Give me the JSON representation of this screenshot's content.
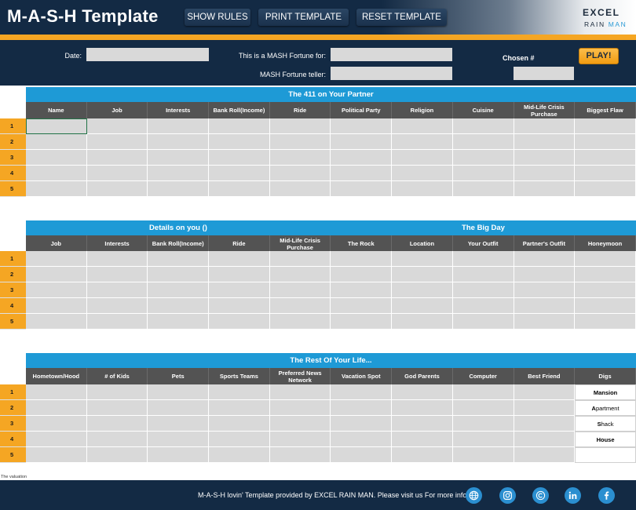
{
  "header": {
    "title": "M-A-S-H  Template",
    "buttons": [
      "SHOW RULES",
      "PRINT TEMPLATE",
      "RESET TEMPLATE"
    ],
    "logo_line1": "EXCEL",
    "logo_rain": "RAIN",
    "logo_man": "MAN"
  },
  "form": {
    "date_label": "Date:",
    "fortune_for_label": "This is a MASH Fortune for:",
    "teller_label": "MASH Fortune teller:",
    "chosen_label": "Chosen #",
    "play_label": "PLAY!",
    "date_value": "",
    "fortune_for_value": "",
    "teller_value": "",
    "chosen_value": ""
  },
  "table1": {
    "title": "The 411 on Your Partner",
    "columns": [
      "Name",
      "Job",
      "Interests",
      "Bank Roll(Income)",
      "Ride",
      "Political Party",
      "Religion",
      "Cuisine",
      "Mid-Life Crisis Purchase",
      "Biggest Flaw"
    ],
    "row_numbers": [
      "1",
      "2",
      "3",
      "4",
      "5"
    ]
  },
  "table2": {
    "title_left": "Details on you ()",
    "title_right": "The Big Day",
    "columns": [
      "Job",
      "Interests",
      "Bank Roll(Income)",
      "Ride",
      "Mid-Life Crisis Purchase",
      "The Rock",
      "Location",
      "Your Outfit",
      "Partner's Outfit",
      "Honeymoon"
    ],
    "row_numbers": [
      "1",
      "2",
      "3",
      "4",
      "5"
    ]
  },
  "table3": {
    "title": "The Rest Of Your Life...",
    "columns": [
      "Hometown/Hood",
      "# of Kids",
      "Pets",
      "Sports Teams",
      "Preferred News Network",
      "Vacation Spot",
      "God Parents",
      "Computer",
      "Best Friend",
      "Digs"
    ],
    "row_numbers": [
      "1",
      "2",
      "3",
      "4",
      "5"
    ],
    "digs": [
      {
        "first": "M",
        "rest": "ansion",
        "all_bold": true
      },
      {
        "first": "A",
        "rest": "partment",
        "all_bold": false
      },
      {
        "first": "S",
        "rest": "hack",
        "all_bold": false
      },
      {
        "first": "H",
        "rest": "ouse",
        "all_bold": true
      }
    ]
  },
  "validation_note": "The valuation",
  "footer": {
    "text": "M-A-S-H lovin' Template provided by EXCEL RAIN MAN. Please visit us For more info.",
    "icons": [
      "globe-icon",
      "instagram-icon",
      "copyright-icon",
      "linkedin-icon",
      "facebook-icon"
    ]
  },
  "colors": {
    "navy": "#132a44",
    "orange": "#f5a623",
    "blue": "#1e9ad6",
    "header_grey": "#535353",
    "cell_grey": "#d9d9d9"
  }
}
